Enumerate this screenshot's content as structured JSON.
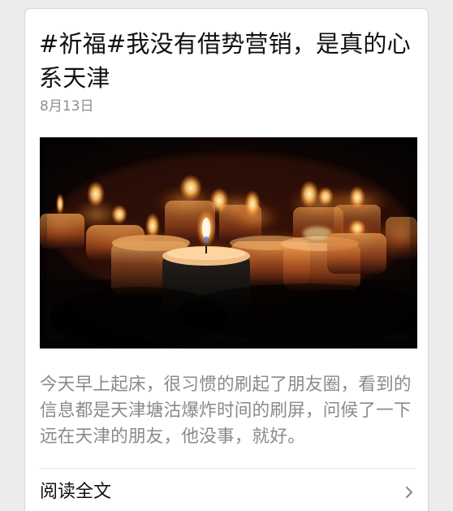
{
  "article": {
    "title": "#祈福#我没有借势营销，是真的心系天津",
    "date": "8月13日",
    "summary": "今天早上起床，很习惯的刷起了朋友圈，看到的信息都是天津塘沽爆炸时间的刷屏，问候了一下远在天津的朋友，他没事，就好。",
    "read_more": "阅读全文"
  },
  "icons": {
    "image": "candles-image",
    "chevron": "chevron-right-icon"
  },
  "colors": {
    "page_background": "#ececec",
    "card_background": "#ffffff",
    "title_text": "#111111",
    "meta_text": "#8f8f8f",
    "summary_text": "#8a8a8a"
  }
}
